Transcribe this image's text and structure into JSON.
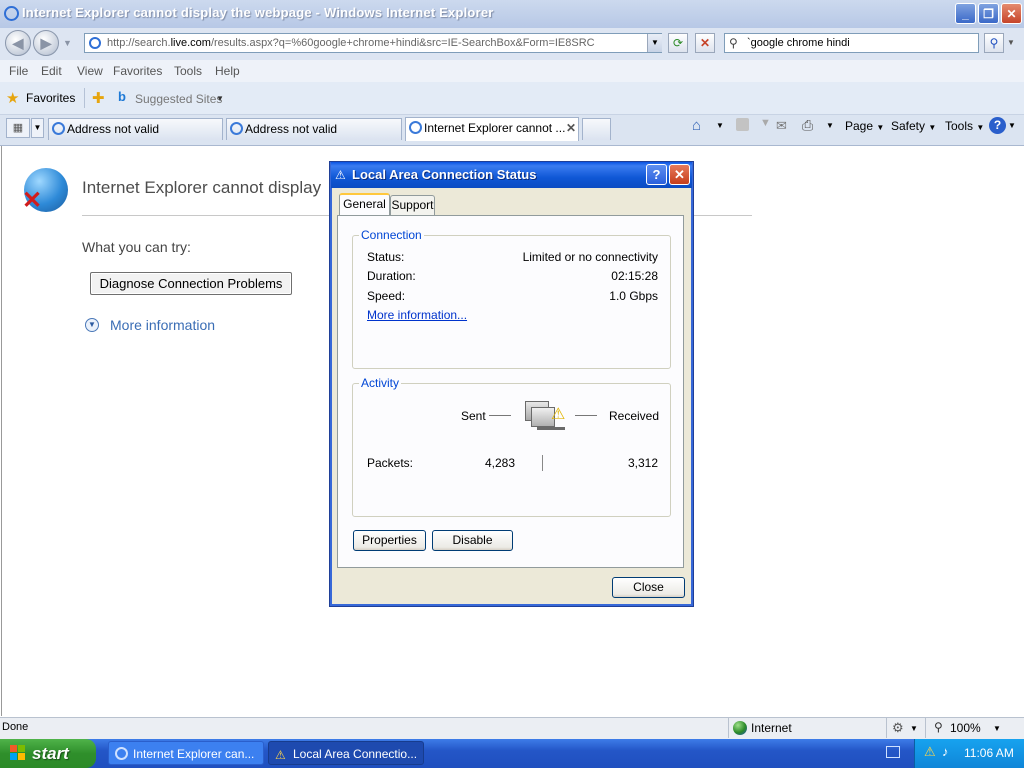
{
  "window": {
    "title": "Internet Explorer cannot display the webpage - Windows Internet Explorer",
    "minimize": "_",
    "restore": "❐",
    "close": "✕"
  },
  "address": {
    "url_prefix": "http://search.",
    "url_domain": "live.com",
    "url_rest": "/results.aspx?q=%60google+chrome+hindi&src=IE-SearchBox&Form=IE8SRC",
    "search_value": "`google chrome hindi"
  },
  "menu": [
    "File",
    "Edit",
    "View",
    "Favorites",
    "Tools",
    "Help"
  ],
  "favorites": {
    "label": "Favorites",
    "suggested": "Suggested Sites"
  },
  "tabs": [
    {
      "label": "Address not valid"
    },
    {
      "label": "Address not valid"
    },
    {
      "label": "Internet Explorer cannot ..."
    }
  ],
  "commandbar": {
    "page": "Page",
    "safety": "Safety",
    "tools": "Tools"
  },
  "page": {
    "error_title": "Internet Explorer cannot display",
    "try_text": "What you can try:",
    "diagnose_button": "Diagnose Connection Problems",
    "more_info": "More information"
  },
  "statusbar": {
    "status": "Done",
    "zone": "Internet",
    "zoom": "100%"
  },
  "taskbar": {
    "start": "start",
    "items": [
      {
        "label": "Internet Explorer can..."
      },
      {
        "label": "Local Area Connectio..."
      }
    ],
    "clock": "11:06 AM"
  },
  "dialog": {
    "title": "Local Area Connection Status",
    "help": "?",
    "close_x": "✕",
    "tabs": [
      "General",
      "Support"
    ],
    "connection": {
      "label": "Connection",
      "status_key": "Status:",
      "status_value": "Limited or no connectivity",
      "duration_key": "Duration:",
      "duration_value": "02:15:28",
      "speed_key": "Speed:",
      "speed_value": "1.0 Gbps",
      "more_link": "More information..."
    },
    "activity": {
      "label": "Activity",
      "sent": "Sent",
      "received": "Received",
      "packets_key": "Packets:",
      "packets_sent": "4,283",
      "packets_received": "3,312"
    },
    "buttons": {
      "properties": "Properties",
      "disable": "Disable",
      "close": "Close"
    }
  }
}
